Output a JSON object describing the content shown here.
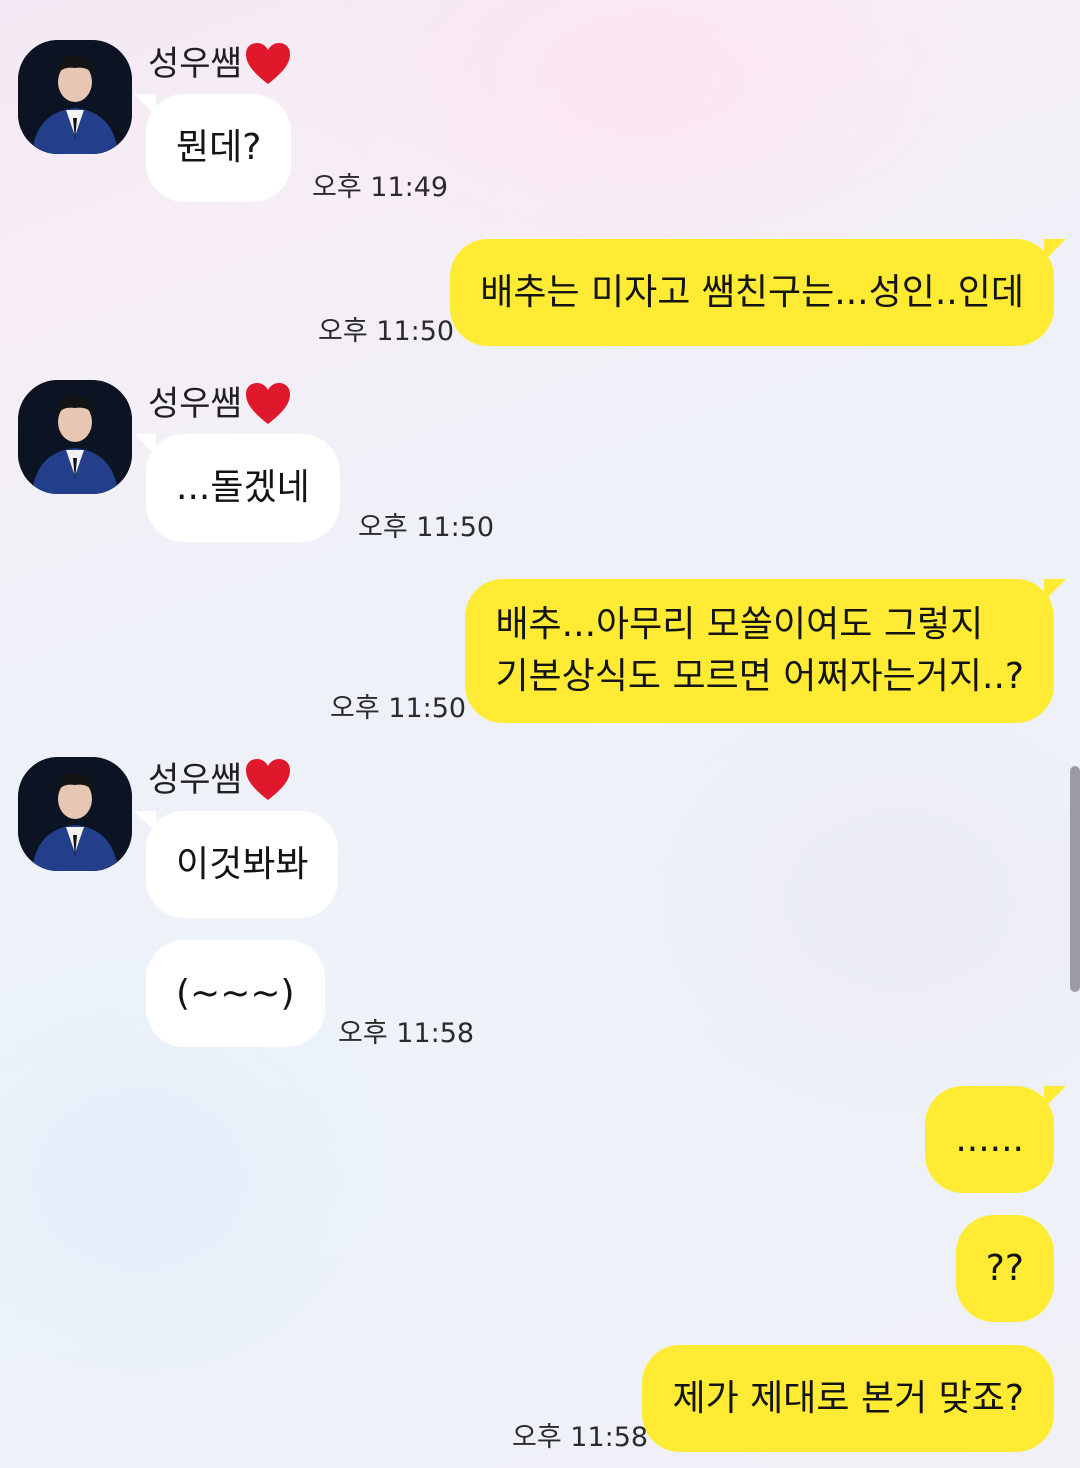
{
  "chat": {
    "sender_name": "성우쌤",
    "messages": [
      {
        "from": "in",
        "text": "뭔데?",
        "time": "오후 11:49"
      },
      {
        "from": "out",
        "text": "배추는 미자고 쌤친구는...성인..인데",
        "time": "오후 11:50"
      },
      {
        "from": "in",
        "text": "...돌겠네",
        "time": "오후 11:50"
      },
      {
        "from": "out",
        "lines": [
          "배추...아무리 모쏠이여도 그렇지",
          "기본상식도 모르면 어쩌자는거지..?"
        ],
        "time": "오후 11:50"
      },
      {
        "from": "in",
        "text": "이것봐봐"
      },
      {
        "from": "in",
        "text": "(~~~)",
        "time": "오후 11:58"
      },
      {
        "from": "out",
        "text": "......"
      },
      {
        "from": "out",
        "text": "??"
      },
      {
        "from": "out",
        "text": "제가 제대로 본거 맞죠?",
        "time": "오후 11:58"
      }
    ]
  },
  "icons": {
    "avatar": "profile-photo",
    "heart": "red-heart-emoji"
  },
  "colors": {
    "outgoing_bubble": "#ffeb33",
    "incoming_bubble": "#ffffff",
    "heart": "#e0182b"
  }
}
